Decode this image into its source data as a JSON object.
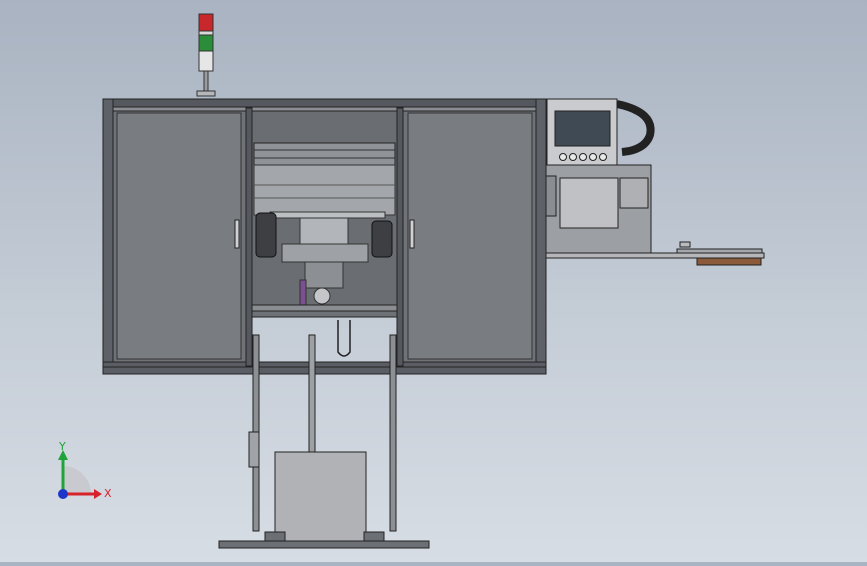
{
  "viewport": {
    "background_top": "#a9b3c1",
    "background_bottom": "#d7dde4"
  },
  "triad": {
    "x_label": "X",
    "y_label": "Y",
    "x_color": "#d8222a",
    "y_color": "#1fa33a",
    "z_color": "#1d35c9"
  },
  "colors": {
    "frame": "#5a5e64",
    "panel": "#7b7e83",
    "panel_dark": "#6c6f74",
    "steel": "#c8cacd",
    "hmi_screen": "#3f4a55",
    "stack_light_red": "#c8272b",
    "stack_light_green": "#2b8c3a"
  }
}
